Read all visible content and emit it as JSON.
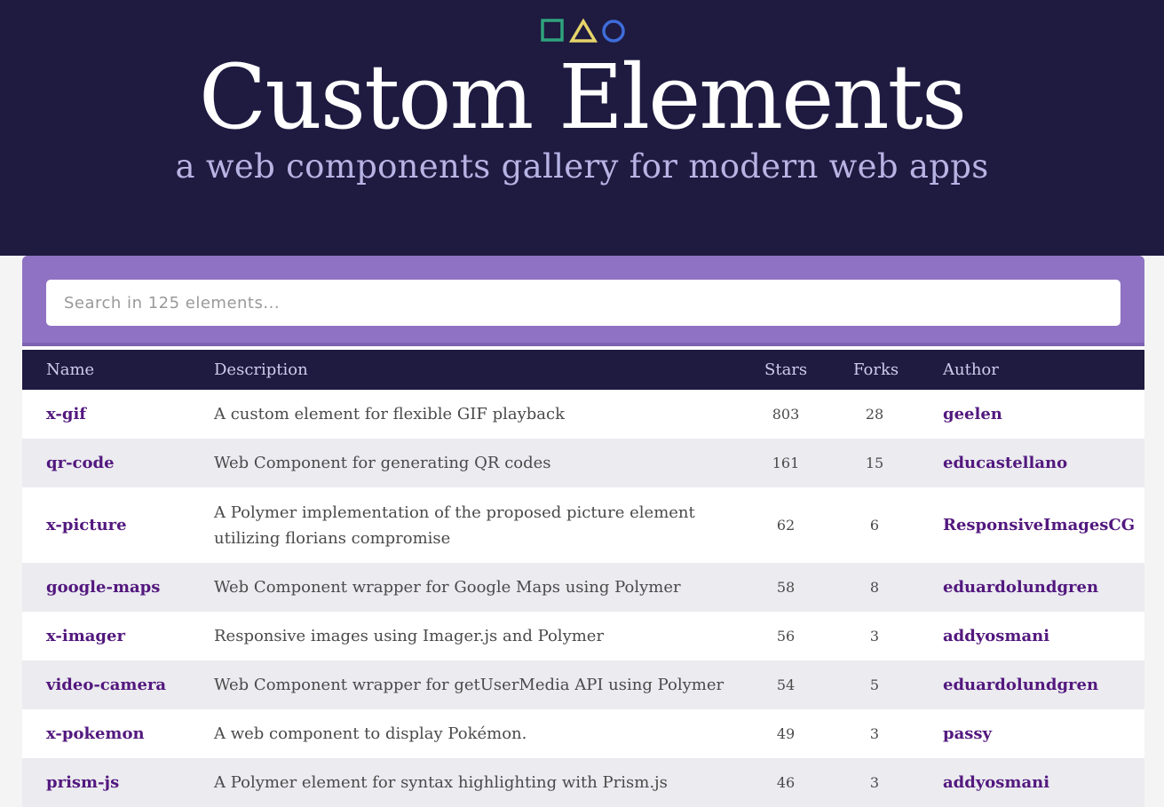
{
  "header": {
    "title": "Custom Elements",
    "subtitle": "a web components gallery for modern web apps",
    "logo_shapes": [
      {
        "icon": "square-icon",
        "color": "#2fa37c"
      },
      {
        "icon": "triangle-icon",
        "color": "#e6d46a"
      },
      {
        "icon": "circle-icon",
        "color": "#3f6cd9"
      }
    ]
  },
  "search": {
    "placeholder": "Search in 125 elements...",
    "value": ""
  },
  "table": {
    "columns": {
      "name": "Name",
      "description": "Description",
      "stars": "Stars",
      "forks": "Forks",
      "author": "Author"
    },
    "rows": [
      {
        "name": "x-gif",
        "description": "A custom element for flexible GIF playback",
        "stars": "803",
        "forks": "28",
        "author": "geelen"
      },
      {
        "name": "qr-code",
        "description": "Web Component for generating QR codes",
        "stars": "161",
        "forks": "15",
        "author": "educastellano"
      },
      {
        "name": "x-picture",
        "description": "A Polymer implementation of the proposed picture element utilizing florians compromise",
        "stars": "62",
        "forks": "6",
        "author": "ResponsiveImagesCG"
      },
      {
        "name": "google-maps",
        "description": "Web Component wrapper for Google Maps using Polymer",
        "stars": "58",
        "forks": "8",
        "author": "eduardolundgren"
      },
      {
        "name": "x-imager",
        "description": "Responsive images using Imager.js and Polymer",
        "stars": "56",
        "forks": "3",
        "author": "addyosmani"
      },
      {
        "name": "video-camera",
        "description": "Web Component wrapper for getUserMedia API using Polymer",
        "stars": "54",
        "forks": "5",
        "author": "eduardolundgren"
      },
      {
        "name": "x-pokemon",
        "description": "A web component to display Pokémon.",
        "stars": "49",
        "forks": "3",
        "author": "passy"
      },
      {
        "name": "prism-js",
        "description": "A Polymer element for syntax highlighting with Prism.js",
        "stars": "46",
        "forks": "3",
        "author": "addyosmani"
      }
    ]
  },
  "colors": {
    "header_bg": "#1e1a40",
    "search_bar_bg": "#8f72c3",
    "link": "#53187e",
    "row_alt": "#ebebf0"
  }
}
